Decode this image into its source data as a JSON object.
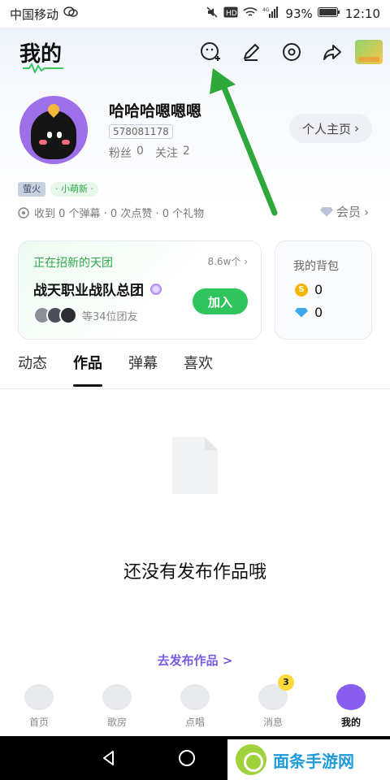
{
  "statusbar": {
    "carrier": "中国移动",
    "battery": "93%",
    "time": "12:10",
    "network": "4G"
  },
  "header": {
    "title": "我的"
  },
  "profile": {
    "username": "哈哈哈嗯嗯嗯",
    "uid": "578081178",
    "fans_label": "粉丝",
    "fans_count": "0",
    "follow_label": "关注",
    "follow_count": "2",
    "home_button": "个人主页",
    "badge_level": "萤火",
    "badge_new": "· 小萌新 ·"
  },
  "received": {
    "text": "收到 0 个弹幕 · 0 次点赞 · 0 个礼物"
  },
  "vip": {
    "label": "会员"
  },
  "recruit_card": {
    "title": "正在招新的天团",
    "count": "8.6w个",
    "team_name": "战天职业战队总团",
    "join_button": "加入",
    "members_text": "等34位团友"
  },
  "bag_card": {
    "title": "我的背包",
    "coins": "0",
    "diamonds": "0"
  },
  "tabs": [
    {
      "label": "动态"
    },
    {
      "label": "作品",
      "active": true
    },
    {
      "label": "弹幕"
    },
    {
      "label": "喜欢"
    }
  ],
  "empty": {
    "message": "还没有发布作品哦",
    "publish_link": "去发布作品 >"
  },
  "bottom_nav": [
    {
      "label": "首页"
    },
    {
      "label": "歌房"
    },
    {
      "label": "点唱"
    },
    {
      "label": "消息",
      "badge": "3"
    },
    {
      "label": "我的",
      "active": true
    }
  ],
  "watermark": {
    "text": "面条手游网"
  },
  "colors": {
    "accent_green": "#2fc45c",
    "accent_purple": "#8a5cf0",
    "annotation_arrow": "#2ea83a"
  }
}
